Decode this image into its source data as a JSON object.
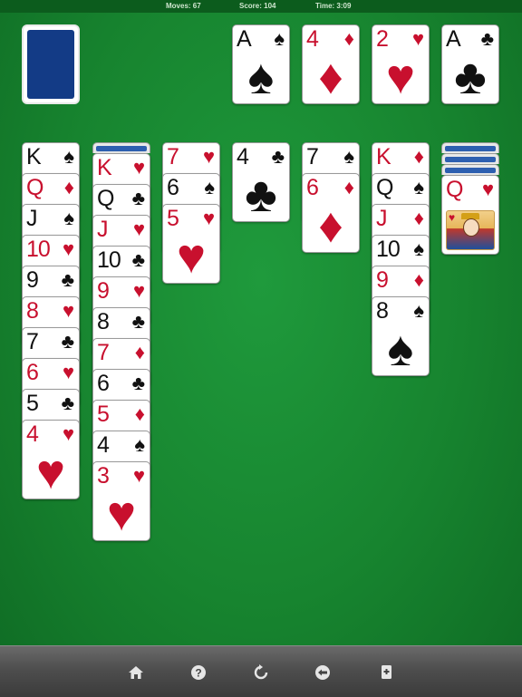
{
  "status": {
    "moves": "Moves: 67",
    "score": "Score: 104",
    "time": "Time: 3:09"
  },
  "colors": {
    "felt": "#17842f",
    "red": "#c8102e",
    "black": "#111111",
    "card_back": "#133b86"
  },
  "foundations": [
    {
      "rank": "A",
      "suit": "♠",
      "color": "black"
    },
    {
      "rank": "4",
      "suit": "♦",
      "color": "red"
    },
    {
      "rank": "2",
      "suit": "♥",
      "color": "red"
    },
    {
      "rank": "A",
      "suit": "♣",
      "color": "black"
    }
  ],
  "tableau": [
    {
      "facedown": 0,
      "cards": [
        {
          "rank": "K",
          "suit": "♠",
          "color": "black"
        },
        {
          "rank": "Q",
          "suit": "♦",
          "color": "red"
        },
        {
          "rank": "J",
          "suit": "♠",
          "color": "black"
        },
        {
          "rank": "10",
          "suit": "♥",
          "color": "red"
        },
        {
          "rank": "9",
          "suit": "♣",
          "color": "black"
        },
        {
          "rank": "8",
          "suit": "♥",
          "color": "red"
        },
        {
          "rank": "7",
          "suit": "♣",
          "color": "black"
        },
        {
          "rank": "6",
          "suit": "♥",
          "color": "red"
        },
        {
          "rank": "5",
          "suit": "♣",
          "color": "black"
        },
        {
          "rank": "4",
          "suit": "♥",
          "color": "red"
        }
      ]
    },
    {
      "facedown": 1,
      "cards": [
        {
          "rank": "K",
          "suit": "♥",
          "color": "red"
        },
        {
          "rank": "Q",
          "suit": "♣",
          "color": "black"
        },
        {
          "rank": "J",
          "suit": "♥",
          "color": "red"
        },
        {
          "rank": "10",
          "suit": "♣",
          "color": "black"
        },
        {
          "rank": "9",
          "suit": "♥",
          "color": "red"
        },
        {
          "rank": "8",
          "suit": "♣",
          "color": "black"
        },
        {
          "rank": "7",
          "suit": "♦",
          "color": "red"
        },
        {
          "rank": "6",
          "suit": "♣",
          "color": "black"
        },
        {
          "rank": "5",
          "suit": "♦",
          "color": "red"
        },
        {
          "rank": "4",
          "suit": "♠",
          "color": "black"
        },
        {
          "rank": "3",
          "suit": "♥",
          "color": "red"
        }
      ]
    },
    {
      "facedown": 0,
      "cards": [
        {
          "rank": "7",
          "suit": "♥",
          "color": "red"
        },
        {
          "rank": "6",
          "suit": "♠",
          "color": "black"
        },
        {
          "rank": "5",
          "suit": "♥",
          "color": "red"
        }
      ]
    },
    {
      "facedown": 0,
      "cards": [
        {
          "rank": "4",
          "suit": "♣",
          "color": "black"
        }
      ]
    },
    {
      "facedown": 0,
      "cards": [
        {
          "rank": "7",
          "suit": "♠",
          "color": "black"
        },
        {
          "rank": "6",
          "suit": "♦",
          "color": "red"
        }
      ]
    },
    {
      "facedown": 0,
      "cards": [
        {
          "rank": "K",
          "suit": "♦",
          "color": "red"
        },
        {
          "rank": "Q",
          "suit": "♠",
          "color": "black"
        },
        {
          "rank": "J",
          "suit": "♦",
          "color": "red"
        },
        {
          "rank": "10",
          "suit": "♠",
          "color": "black"
        },
        {
          "rank": "9",
          "suit": "♦",
          "color": "red"
        },
        {
          "rank": "8",
          "suit": "♠",
          "color": "black"
        }
      ]
    },
    {
      "facedown": 3,
      "cards": [
        {
          "rank": "Q",
          "suit": "♥",
          "color": "red",
          "face_art": "queen-of-hearts"
        }
      ]
    }
  ],
  "toolbar": [
    {
      "name": "home-button",
      "icon": "home-icon"
    },
    {
      "name": "help-button",
      "icon": "help-icon"
    },
    {
      "name": "restart-button",
      "icon": "restart-icon"
    },
    {
      "name": "undo-button",
      "icon": "undo-icon"
    },
    {
      "name": "new-game-button",
      "icon": "new-card-icon"
    }
  ]
}
